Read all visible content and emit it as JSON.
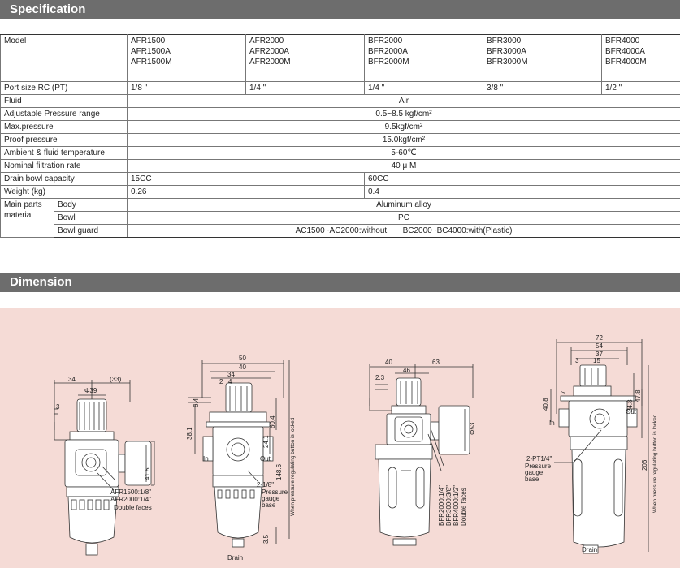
{
  "specification": {
    "title": "Specification",
    "model_label": "Model",
    "models": [
      [
        "AFR1500",
        "AFR1500A",
        "AFR1500M"
      ],
      [
        "AFR2000",
        "AFR2000A",
        "AFR2000M"
      ],
      [
        "BFR2000",
        "BFR2000A",
        "BFR2000M"
      ],
      [
        "BFR3000",
        "BFR3000A",
        "BFR3000M"
      ],
      [
        "BFR4000",
        "BFR4000A",
        "BFR4000M"
      ]
    ],
    "port_label": "Port size RC (PT)",
    "port_sizes": [
      "1/8 \"",
      "1/4 \"",
      "1/4 \"",
      "3/8 \"",
      "1/2 \""
    ],
    "fluid_label": "Fluid",
    "fluid": "Air",
    "pressure_range_label": "Adjustable Pressure range",
    "pressure_range": "0.5~8.5 kgf/cm²",
    "max_pressure_label": "Max.pressure",
    "max_pressure": "9.5kgf/cm²",
    "proof_pressure_label": "Proof pressure",
    "proof_pressure": "15.0kgf/cm²",
    "temperature_label": "Ambient & fluid temperature",
    "temperature": "5-60℃",
    "filtration_label": "Nominal filtration rate",
    "filtration": "40 μ M",
    "drain_label": "Drain bowl capacity",
    "drain_values": [
      "15CC",
      "60CC"
    ],
    "weight_label": "Weight (kg)",
    "weight_values": [
      "0.26",
      "0.4"
    ],
    "main_parts_label": "Main parts material",
    "parts": [
      {
        "name": "Body",
        "value": "Aluminum alloy"
      },
      {
        "name": "Bowl",
        "value": "PC"
      },
      {
        "name": "Bowl guard",
        "value": "AC1500~AC2000:without       BC2000~BC4000:with(Plastic)"
      }
    ]
  },
  "dimension": {
    "title": "Dimension",
    "fig1": {
      "d_top_left": "34",
      "d_top_right": "(33)",
      "d_phi": "Φ39",
      "d_3": "3",
      "d_415": "41.5",
      "label_port_a": "AFR1500:1/8\"",
      "label_port_b": "AFR2000:1/4\"",
      "label_faces": "Double faces"
    },
    "fig2": {
      "d50": "50",
      "d40": "40",
      "d34": "34",
      "d2": "2",
      "d4": "4",
      "d64": "6.4",
      "d381": "38.1",
      "d604": "60.4",
      "d241": "24.1",
      "d1486": "148.6",
      "d35": "3.5",
      "label_in": "In",
      "label_out": "Out",
      "label_gauge": "2-1/8\"",
      "label_gauge2": "Pressure",
      "label_gauge3": "gauge",
      "label_gauge4": "base",
      "label_lock": "When pressure regulating button is locked",
      "label_drain": "Drain"
    },
    "fig3": {
      "d40": "40",
      "d63": "63",
      "d46": "46",
      "d23": "2.3",
      "d53": "Φ53",
      "label_ports": [
        "BFR2000:1/4\"",
        "BFR3000:3/8\"",
        "BFR4000:1/2\""
      ],
      "label_faces": "Double faces"
    },
    "fig4": {
      "d72": "72",
      "d54": "54",
      "d37": "37",
      "d3": "3",
      "d15": "15",
      "d7": "7",
      "d408": "40.8",
      "d248": "24.8",
      "d478": "47.8",
      "d206": "206",
      "label_in": "In",
      "label_out": "Out",
      "label_gauge": "2-PT1/4\"",
      "label_gauge2": "Pressure",
      "label_gauge3": "gauge",
      "label_gauge4": "base",
      "label_lock": "When pressure regulating button is locked",
      "label_drain": "Drain"
    }
  }
}
